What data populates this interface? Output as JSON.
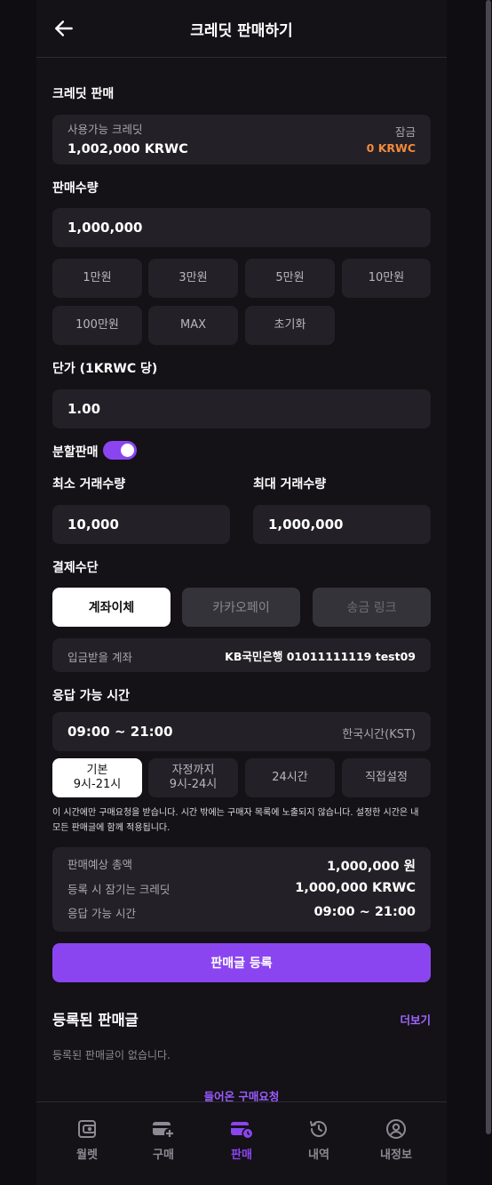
{
  "header": {
    "title": "크레딧 판매하기",
    "back_icon": "arrow-left-icon"
  },
  "credit_sale": {
    "section_label": "크레딧 판매",
    "available_label": "사용가능 크레딧",
    "available_value": "1,002,000 KRWC",
    "locked_label": "잠금",
    "locked_value": "0 KRWC",
    "locked_color": "#f28a3c"
  },
  "quantity": {
    "label": "판매수량",
    "value": "1,000,000",
    "presets": [
      "1만원",
      "3만원",
      "5만원",
      "10만원",
      "100만원",
      "MAX",
      "초기화"
    ]
  },
  "unit_price": {
    "label": "단가 (1KRWC 당)",
    "value": "1.00"
  },
  "split_sale": {
    "label": "분할판매",
    "enabled": true
  },
  "min_qty": {
    "label": "최소 거래수량",
    "value": "10,000"
  },
  "max_qty": {
    "label": "최대 거래수량",
    "value": "1,000,000"
  },
  "payment": {
    "label": "결제수단",
    "methods": [
      "계좌이체",
      "카카오페이",
      "송금 링크"
    ],
    "selected": "계좌이체",
    "account_label": "입금받을 계좌",
    "account_value": "KB국민은행 01011111119 test09"
  },
  "response_time": {
    "label": "응답 가능 시간",
    "value": "09:00 ~ 21:00",
    "timezone": "한국시간(KST)",
    "options": [
      {
        "title": "기본",
        "sub": "9시-21시"
      },
      {
        "title": "자정까지",
        "sub": "9시-24시"
      },
      {
        "title": "24시간",
        "sub": ""
      },
      {
        "title": "직접설정",
        "sub": ""
      }
    ],
    "notice_line1": "이 시간에만 구매요청을 받습니다. 시간 밖에는 구매자 목록에 노출되지 않습니다. 설정한 시간은 내",
    "notice_line2": "모든 판매글에 함께 적용됩니다."
  },
  "summary": {
    "total_label": "판매예상 총액",
    "total_value": "1,000,000 원",
    "locked_label": "등록 시 잠기는 크레딧",
    "locked_value": "1,000,000 KRWC",
    "time_label": "응답 가능 시간",
    "time_value": "09:00 ~ 21:00"
  },
  "submit_label": "판매글 등록",
  "accent_color": "#8b45f0",
  "registered": {
    "title": "등록된 판매글",
    "more_label": "더보기",
    "empty_text": "등록된 판매글이 없습니다.",
    "incoming_link": "들어온 구매요청"
  },
  "nav": {
    "items": [
      {
        "label": "월렛",
        "icon": "wallet-icon"
      },
      {
        "label": "구매",
        "icon": "card-plus-icon"
      },
      {
        "label": "판매",
        "icon": "card-clock-icon"
      },
      {
        "label": "내역",
        "icon": "history-icon"
      },
      {
        "label": "내정보",
        "icon": "user-icon"
      }
    ],
    "active": "판매"
  }
}
